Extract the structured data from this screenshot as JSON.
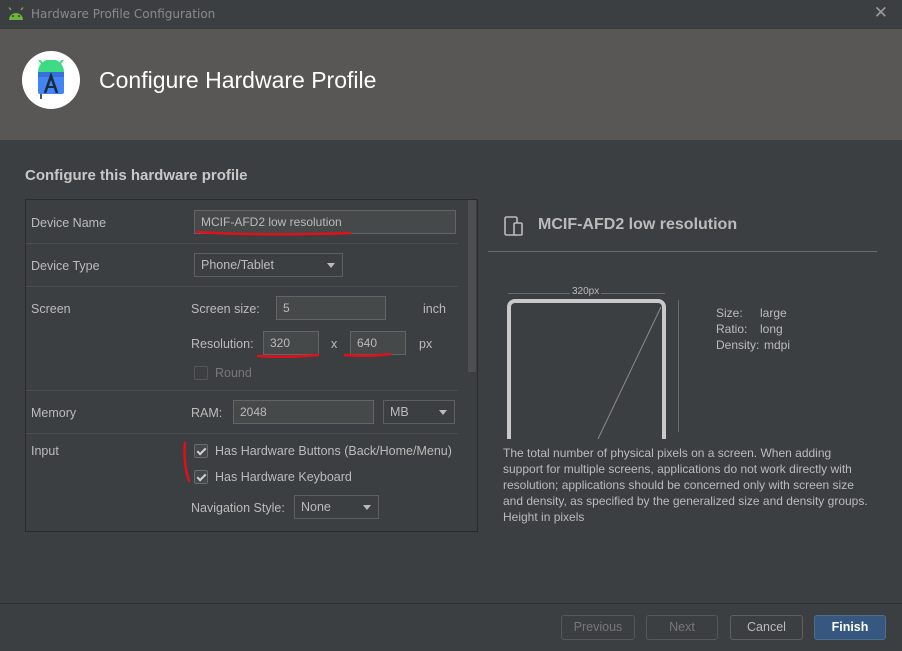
{
  "window": {
    "title": "Hardware Profile Configuration",
    "close_glyph": "✕"
  },
  "header": {
    "title": "Configure Hardware Profile"
  },
  "main": {
    "section_title": "Configure this hardware profile"
  },
  "form": {
    "device_name": {
      "label": "Device Name",
      "value": "MCIF-AFD2 low resolution"
    },
    "device_type": {
      "label": "Device Type",
      "value": "Phone/Tablet"
    },
    "screen": {
      "label": "Screen",
      "size_label": "Screen size:",
      "size_value": "5",
      "size_unit": "inch",
      "resolution_label": "Resolution:",
      "res_width": "320",
      "res_sep": "x",
      "res_height": "640",
      "res_unit": "px",
      "round_label": "Round",
      "round_checked": false
    },
    "memory": {
      "label": "Memory",
      "ram_label": "RAM:",
      "ram_value": "2048",
      "ram_unit": "MB"
    },
    "input": {
      "label": "Input",
      "hw_buttons_label": "Has Hardware Buttons (Back/Home/Menu)",
      "hw_buttons_checked": true,
      "hw_keyboard_label": "Has Hardware Keyboard",
      "hw_keyboard_checked": true,
      "nav_style_label": "Navigation Style:",
      "nav_style_value": "None"
    }
  },
  "preview": {
    "name": "MCIF-AFD2 low resolution",
    "width_label": "320px",
    "size_label": "Size:",
    "size_value": "large",
    "ratio_label": "Ratio:",
    "ratio_value": "long",
    "density_label": "Density:",
    "density_value": "mdpi",
    "description": "The total number of physical pixels on a screen. When adding support for multiple screens, applications do not work directly with resolution; applications should be concerned only with screen size and density, as specified by the generalized size and density groups. Height in pixels"
  },
  "footer": {
    "previous": "Previous",
    "next": "Next",
    "cancel": "Cancel",
    "finish": "Finish"
  },
  "colors": {
    "background": "#3c3f41",
    "header_band": "#595755",
    "primary_button": "#365880",
    "annotation_red": "#e0101a"
  }
}
